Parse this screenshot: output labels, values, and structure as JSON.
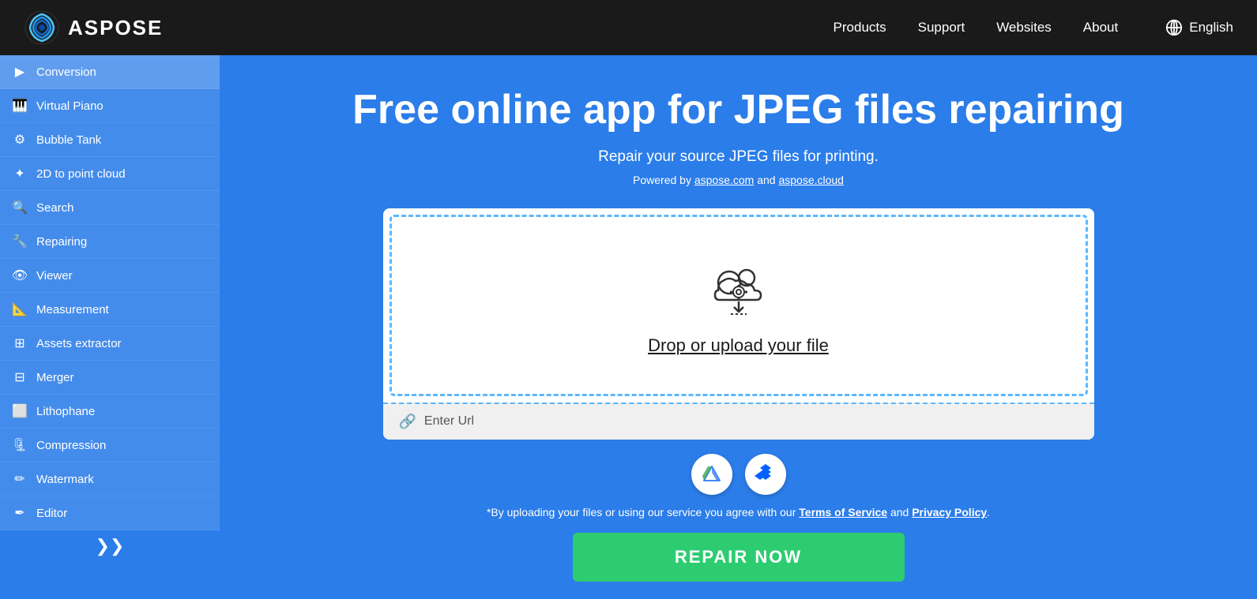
{
  "header": {
    "logo_text": "ASPOSE",
    "nav": {
      "products": "Products",
      "support": "Support",
      "websites": "Websites",
      "about": "About"
    },
    "language": "English"
  },
  "sidebar": {
    "items": [
      {
        "id": "conversion",
        "label": "Conversion",
        "icon": "▶",
        "active": true
      },
      {
        "id": "virtual-piano",
        "label": "Virtual Piano",
        "icon": "🎹"
      },
      {
        "id": "bubble-tank",
        "label": "Bubble Tank",
        "icon": "⚙"
      },
      {
        "id": "2d-point-cloud",
        "label": "2D to point cloud",
        "icon": "✦"
      },
      {
        "id": "search",
        "label": "Search",
        "icon": "🔍"
      },
      {
        "id": "repairing",
        "label": "Repairing",
        "icon": "🔧"
      },
      {
        "id": "viewer",
        "label": "Viewer",
        "icon": "👁"
      },
      {
        "id": "measurement",
        "label": "Measurement",
        "icon": "📐"
      },
      {
        "id": "assets-extractor",
        "label": "Assets extractor",
        "icon": "⊞"
      },
      {
        "id": "merger",
        "label": "Merger",
        "icon": "⊟"
      },
      {
        "id": "lithophane",
        "label": "Lithophane",
        "icon": "⬜"
      },
      {
        "id": "compression",
        "label": "Compression",
        "icon": "🗜"
      },
      {
        "id": "watermark",
        "label": "Watermark",
        "icon": "✏"
      },
      {
        "id": "editor",
        "label": "Editor",
        "icon": "🖊"
      }
    ],
    "more_icon": "❯❯"
  },
  "main": {
    "title": "Free online app for JPEG files repairing",
    "subtitle": "Repair your source JPEG files for printing.",
    "powered_by_text": "Powered by ",
    "powered_by_link1": "aspose.com",
    "powered_by_and": " and ",
    "powered_by_link2": "aspose.cloud",
    "upload_label": "Drop or upload your file",
    "enter_url_label": "Enter Url",
    "terms_prefix": "*By uploading your files or using our service you agree with our ",
    "terms_link": "Terms of Service",
    "terms_and": " and ",
    "privacy_link": "Privacy Policy",
    "terms_suffix": ".",
    "repair_button": "REPAIR NOW"
  }
}
